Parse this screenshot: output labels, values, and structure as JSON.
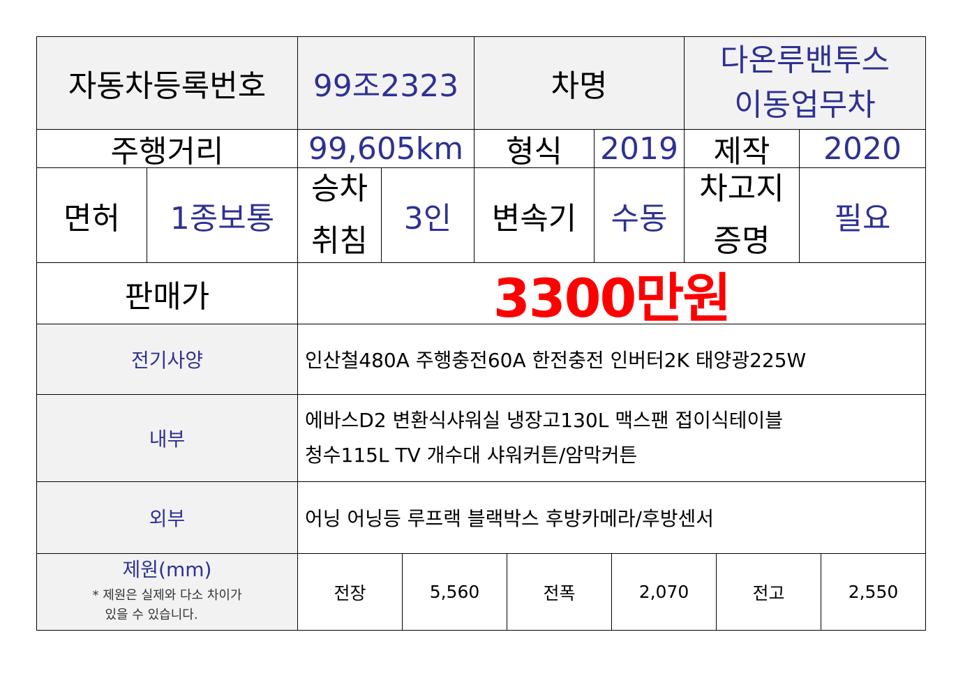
{
  "row1": {
    "reg_label": "자동차등록번호",
    "reg_value": "99조2323",
    "name_label": "차명",
    "name_value_line1": "다온루밴투스",
    "name_value_line2": "이동업무차"
  },
  "row2": {
    "mileage_label": "주행거리",
    "mileage_value": "99,605km",
    "type_label": "형식",
    "type_value": "2019",
    "make_label": "제작",
    "make_value": "2020"
  },
  "row3": {
    "license_label": "면허",
    "license_value": "1종보통",
    "seats_label_line1": "승차",
    "seats_label_line2": "취침",
    "seats_value": "3인",
    "trans_label": "변속기",
    "trans_value": "수동",
    "garage_label_line1": "차고지",
    "garage_label_line2": "증명",
    "garage_value": "필요"
  },
  "price": {
    "label": "판매가",
    "value": "3300만원"
  },
  "electric": {
    "label": "전기사양",
    "value": "인산철480A 주행충전60A 한전충전 인버터2K 태양광225W"
  },
  "interior": {
    "label": "내부",
    "line1": "에바스D2 변환식샤워실 냉장고130L 맥스팬 접이식테이블",
    "line2": "청수115L TV 개수대 샤워커튼/암막커튼"
  },
  "exterior": {
    "label": "외부",
    "value": "어닝 어닝등 루프랙 블랙박스 후방카메라/후방센서"
  },
  "dims": {
    "label": "제원(mm)",
    "note_line1": "* 제원은 실제와 다소 차이가",
    "note_line2": "있을 수 있습니다.",
    "length_label": "전장",
    "length_value": "5,560",
    "width_label": "전폭",
    "width_value": "2,070",
    "height_label": "전고",
    "height_value": "2,550"
  },
  "colors": {
    "label_text": "#000000",
    "value_text": "#2e3192",
    "price_text": "#ff0000",
    "label_bg": "#f2f2f2"
  }
}
